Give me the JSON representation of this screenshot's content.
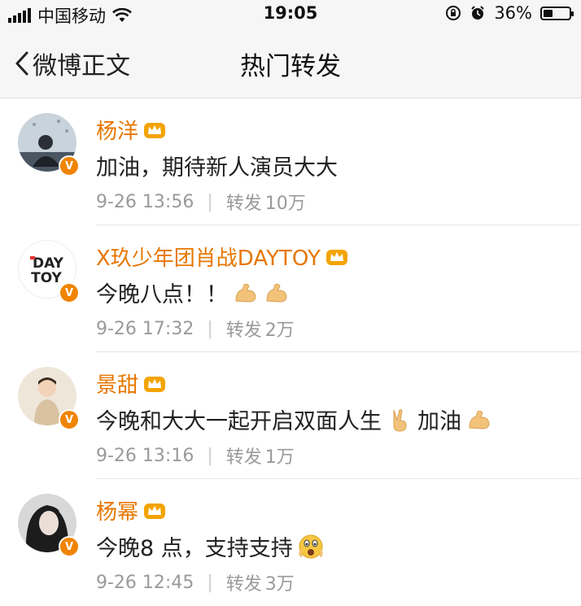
{
  "status_bar": {
    "carrier": "中国移动",
    "time": "19:05",
    "battery_percent": "36%",
    "battery_level": 0.36
  },
  "nav": {
    "back_label": "微博正文",
    "title": "热门转发"
  },
  "reposts": [
    {
      "user": "杨洋",
      "text": "加油，期待新人演员大大",
      "emojis": [],
      "time": "9-26 13:56",
      "repost_label": "转发",
      "repost_count": "10万",
      "avatar_icon": "avatar-photo-icon"
    },
    {
      "user": "X玖少年团肖战DAYTOY",
      "text": "今晚八点！！",
      "emojis": [
        "flexed-biceps-icon",
        "flexed-biceps-icon"
      ],
      "time": "9-26 17:32",
      "repost_label": "转发",
      "repost_count": "2万",
      "avatar_logo_line1": "DAY",
      "avatar_logo_line2": "TOY"
    },
    {
      "user": "景甜",
      "text": "今晚和大大一起开启双面人生",
      "text_suffix": "加油",
      "emojis": [
        "victory-hand-icon",
        "flexed-biceps-icon"
      ],
      "time": "9-26 13:16",
      "repost_label": "转发",
      "repost_count": "1万",
      "avatar_icon": "avatar-photo-icon"
    },
    {
      "user": "杨幂",
      "text": "今晚8 点，支持支持",
      "emojis": [
        "surprised-face-icon"
      ],
      "time": "9-26 12:45",
      "repost_label": "转发",
      "repost_count": "3万",
      "avatar_icon": "avatar-photo-icon"
    }
  ],
  "colors": {
    "username": "#e67700",
    "verified_badge": "#f08400",
    "meta": "#9a9a9a"
  }
}
